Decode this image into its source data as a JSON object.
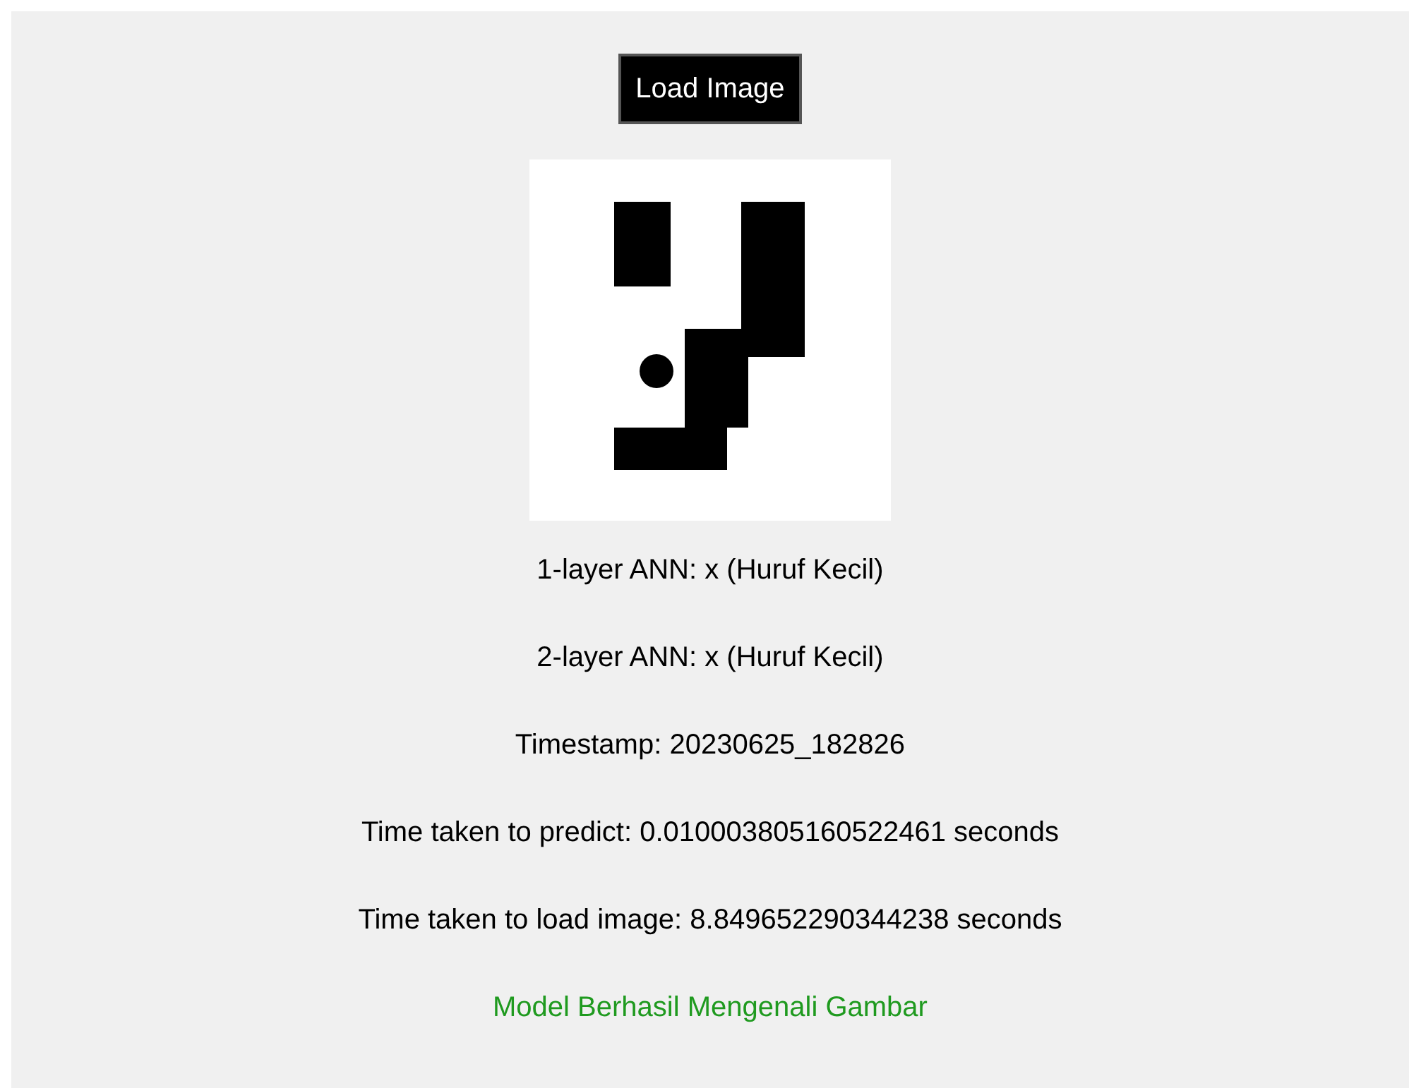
{
  "button": {
    "label": "Load Image"
  },
  "results": [
    {
      "text": "1-layer ANN: x (Huruf Kecil)",
      "kind": "plain"
    },
    {
      "text": "2-layer ANN: x (Huruf Kecil)",
      "kind": "plain"
    },
    {
      "text": "Timestamp: 20230625_182826",
      "kind": "plain"
    },
    {
      "text": "Time taken to predict: 0.010003805160522461 seconds",
      "kind": "plain"
    },
    {
      "text": "Time taken to load image: 8.849652290344238 seconds",
      "kind": "plain"
    },
    {
      "text": "Model Berhasil Mengenali Gambar",
      "kind": "success"
    }
  ]
}
